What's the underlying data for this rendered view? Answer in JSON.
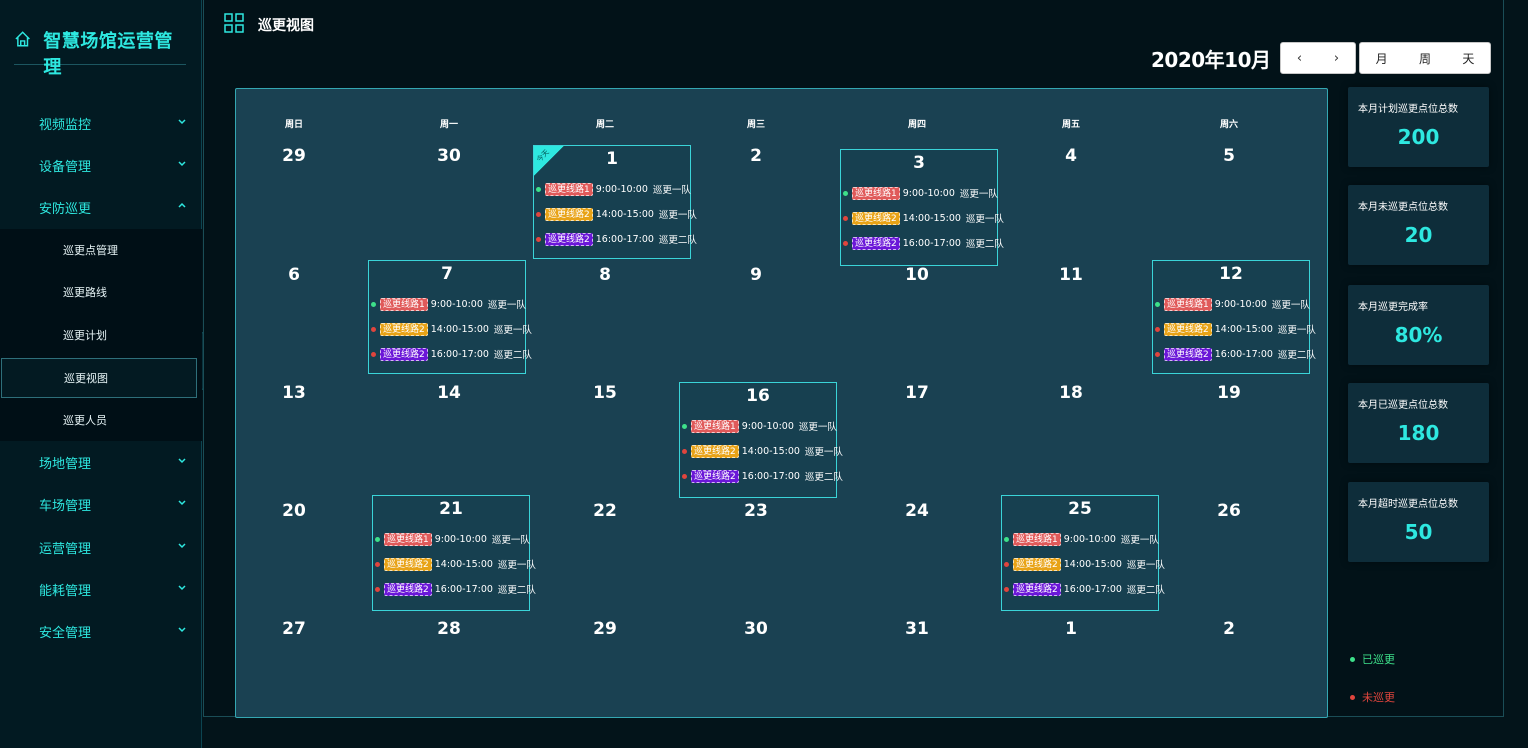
{
  "app": {
    "title": "智慧场馆运营管理"
  },
  "menu": [
    {
      "label": "视频监控"
    },
    {
      "label": "设备管理"
    },
    {
      "label": "安防巡更"
    },
    {
      "label": "场地管理"
    },
    {
      "label": "车场管理"
    },
    {
      "label": "运营管理"
    },
    {
      "label": "能耗管理"
    },
    {
      "label": "安全管理"
    }
  ],
  "submenu": [
    {
      "label": "巡更点管理"
    },
    {
      "label": "巡更路线"
    },
    {
      "label": "巡更计划"
    },
    {
      "label": "巡更视图",
      "active": true
    },
    {
      "label": "巡更人员"
    }
  ],
  "page": {
    "title": "巡更视图"
  },
  "calendar": {
    "month_label": "2020年10月",
    "nav": {
      "prev": "‹",
      "next": "›"
    },
    "views": [
      "月",
      "周",
      "天"
    ],
    "weekdays": [
      "周日",
      "周一",
      "周二",
      "周三",
      "周四",
      "周五",
      "周六"
    ],
    "weeks": [
      [
        "29",
        "30",
        "1",
        "2",
        "3",
        "4",
        "5"
      ],
      [
        "6",
        "7",
        "8",
        "9",
        "10",
        "11",
        "12"
      ],
      [
        "13",
        "14",
        "15",
        "16",
        "17",
        "18",
        "19"
      ],
      [
        "20",
        "21",
        "22",
        "23",
        "24",
        "25",
        "26"
      ],
      [
        "27",
        "28",
        "29",
        "30",
        "31",
        "1",
        "2"
      ]
    ],
    "today_label": "今天",
    "event_days": [
      "1",
      "3",
      "7",
      "12",
      "16",
      "21",
      "25"
    ],
    "events": [
      {
        "route": "巡更线路1",
        "time": "9:00-10:00",
        "team": "巡更一队",
        "tag_color": "#e05a5a",
        "status_color": "#3de08a"
      },
      {
        "route": "巡更线路2",
        "time": "14:00-15:00",
        "team": "巡更一队",
        "tag_color": "#e8a317",
        "status_color": "#e0453d"
      },
      {
        "route": "巡更线路2",
        "time": "16:00-17:00",
        "team": "巡更二队",
        "tag_color": "#6b17d8",
        "status_color": "#e0453d"
      }
    ]
  },
  "stats": [
    {
      "label": "本月计划巡更点位总数",
      "value": "200"
    },
    {
      "label": "本月未巡更点位总数",
      "value": "20"
    },
    {
      "label": "本月巡更完成率",
      "value": "80%"
    },
    {
      "label": "本月已巡更点位总数",
      "value": "180"
    },
    {
      "label": "本月超时巡更点位总数",
      "value": "50"
    }
  ],
  "legend": [
    {
      "label": "已巡更",
      "color": "#3de08a"
    },
    {
      "label": "未巡更",
      "color": "#e0453d"
    }
  ]
}
